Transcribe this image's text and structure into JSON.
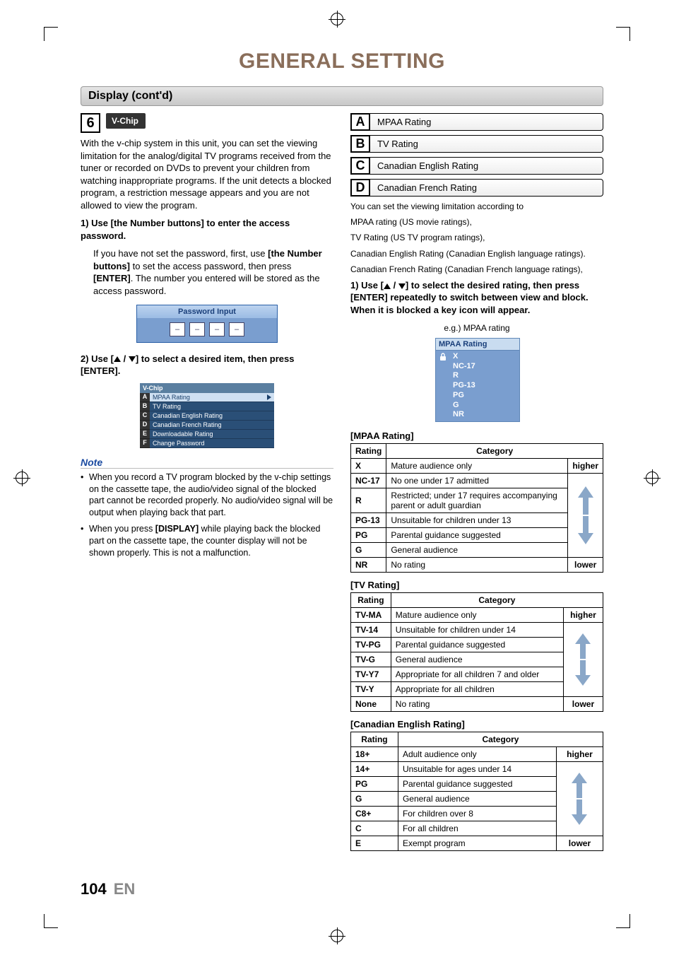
{
  "page_title": "GENERAL SETTING",
  "section_bar": "Display (cont'd)",
  "step6": {
    "number": "6",
    "chip": "V-Chip"
  },
  "intro": "With the v-chip system in this unit, you can set the viewing limitation for the analog/digital TV programs received from the tuner or recorded on DVDs to prevent your children from watching inappropriate programs. If the unit detects a blocked program, a restriction message appears and you are not allowed to view the program.",
  "sub1_head": "1) Use [the Number buttons] to enter the access password.",
  "sub1_body_a": "If you have not set the password, first, use ",
  "sub1_body_b": "[the Number buttons]",
  "sub1_body_c": " to set the access password, then press ",
  "sub1_body_d": "[ENTER]",
  "sub1_body_e": ". The number you entered will be stored as the access password.",
  "pwd_header": "Password Input",
  "pwd_dash": "–",
  "sub2_head_a": "2) Use [",
  "sub2_head_b": "] to select a desired item, then press [ENTER].",
  "vchip_menu": {
    "title": "V-Chip",
    "items": [
      {
        "letter": "A",
        "label": "MPAA Rating",
        "selected": true
      },
      {
        "letter": "B",
        "label": "TV Rating"
      },
      {
        "letter": "C",
        "label": "Canadian English Rating"
      },
      {
        "letter": "D",
        "label": "Canadian French Rating"
      },
      {
        "letter": "E",
        "label": "Downloadable Rating"
      },
      {
        "letter": "F",
        "label": "Change Password"
      }
    ]
  },
  "note_title": "Note",
  "notes": [
    "When you record a TV program blocked by the v-chip settings on the cassette tape, the audio/video signal of the blocked part cannot be recorded properly. No audio/video signal will be output when playing back that part.",
    "When you press [DISPLAY] while playing back the blocked part on the cassette tape, the counter display will not be shown properly. This is not a malfunction."
  ],
  "note2_bold": "[DISPLAY]",
  "options": [
    {
      "letter": "A",
      "label": "MPAA Rating"
    },
    {
      "letter": "B",
      "label": "TV Rating"
    },
    {
      "letter": "C",
      "label": "Canadian English Rating"
    },
    {
      "letter": "D",
      "label": "Canadian French Rating"
    }
  ],
  "option_desc": [
    "You can set the viewing limitation according to",
    "MPAA rating (US movie ratings),",
    "TV Rating (US TV program ratings),",
    "Canadian English Rating (Canadian English language ratings).",
    "Canadian French Rating (Canadian French language ratings),"
  ],
  "right_step1_a": "1) Use [",
  "right_step1_b": "] to select the desired rating, then press [ENTER] repeatedly to switch between view and block. When it is blocked a key icon will appear.",
  "eg_label": "e.g.) MPAA rating",
  "mpaa_popup": {
    "title": "MPAA Rating",
    "items": [
      "X",
      "NC-17",
      "R",
      "PG-13",
      "PG",
      "G",
      "NR"
    ]
  },
  "mpaa_label": "[MPAA Rating]",
  "tv_label": "[TV Rating]",
  "ce_label": "[Canadian English Rating]",
  "th_rating": "Rating",
  "th_category": "Category",
  "scale_hi": "higher",
  "scale_lo": "lower",
  "mpaa_rows": [
    {
      "r": "X",
      "c": "Mature audience only"
    },
    {
      "r": "NC-17",
      "c": "No one under 17 admitted"
    },
    {
      "r": "R",
      "c": "Restricted; under 17 requires accompanying parent or adult guardian"
    },
    {
      "r": "PG-13",
      "c": "Unsuitable for children under 13"
    },
    {
      "r": "PG",
      "c": "Parental guidance suggested"
    },
    {
      "r": "G",
      "c": "General audience"
    },
    {
      "r": "NR",
      "c": "No rating"
    }
  ],
  "tv_rows": [
    {
      "r": "TV-MA",
      "c": "Mature audience only"
    },
    {
      "r": "TV-14",
      "c": "Unsuitable for children under 14"
    },
    {
      "r": "TV-PG",
      "c": "Parental guidance suggested"
    },
    {
      "r": "TV-G",
      "c": "General audience"
    },
    {
      "r": "TV-Y7",
      "c": "Appropriate for all children 7 and older"
    },
    {
      "r": "TV-Y",
      "c": "Appropriate for all children"
    },
    {
      "r": "None",
      "c": "No rating"
    }
  ],
  "ce_rows": [
    {
      "r": "18+",
      "c": "Adult audience only"
    },
    {
      "r": "14+",
      "c": "Unsuitable for ages under 14"
    },
    {
      "r": "PG",
      "c": "Parental guidance suggested"
    },
    {
      "r": "G",
      "c": "General audience"
    },
    {
      "r": "C8+",
      "c": "For children over 8"
    },
    {
      "r": "C",
      "c": "For all children"
    },
    {
      "r": "E",
      "c": "Exempt program"
    }
  ],
  "footer": {
    "page": "104",
    "lang": "EN"
  },
  "slash": " / "
}
